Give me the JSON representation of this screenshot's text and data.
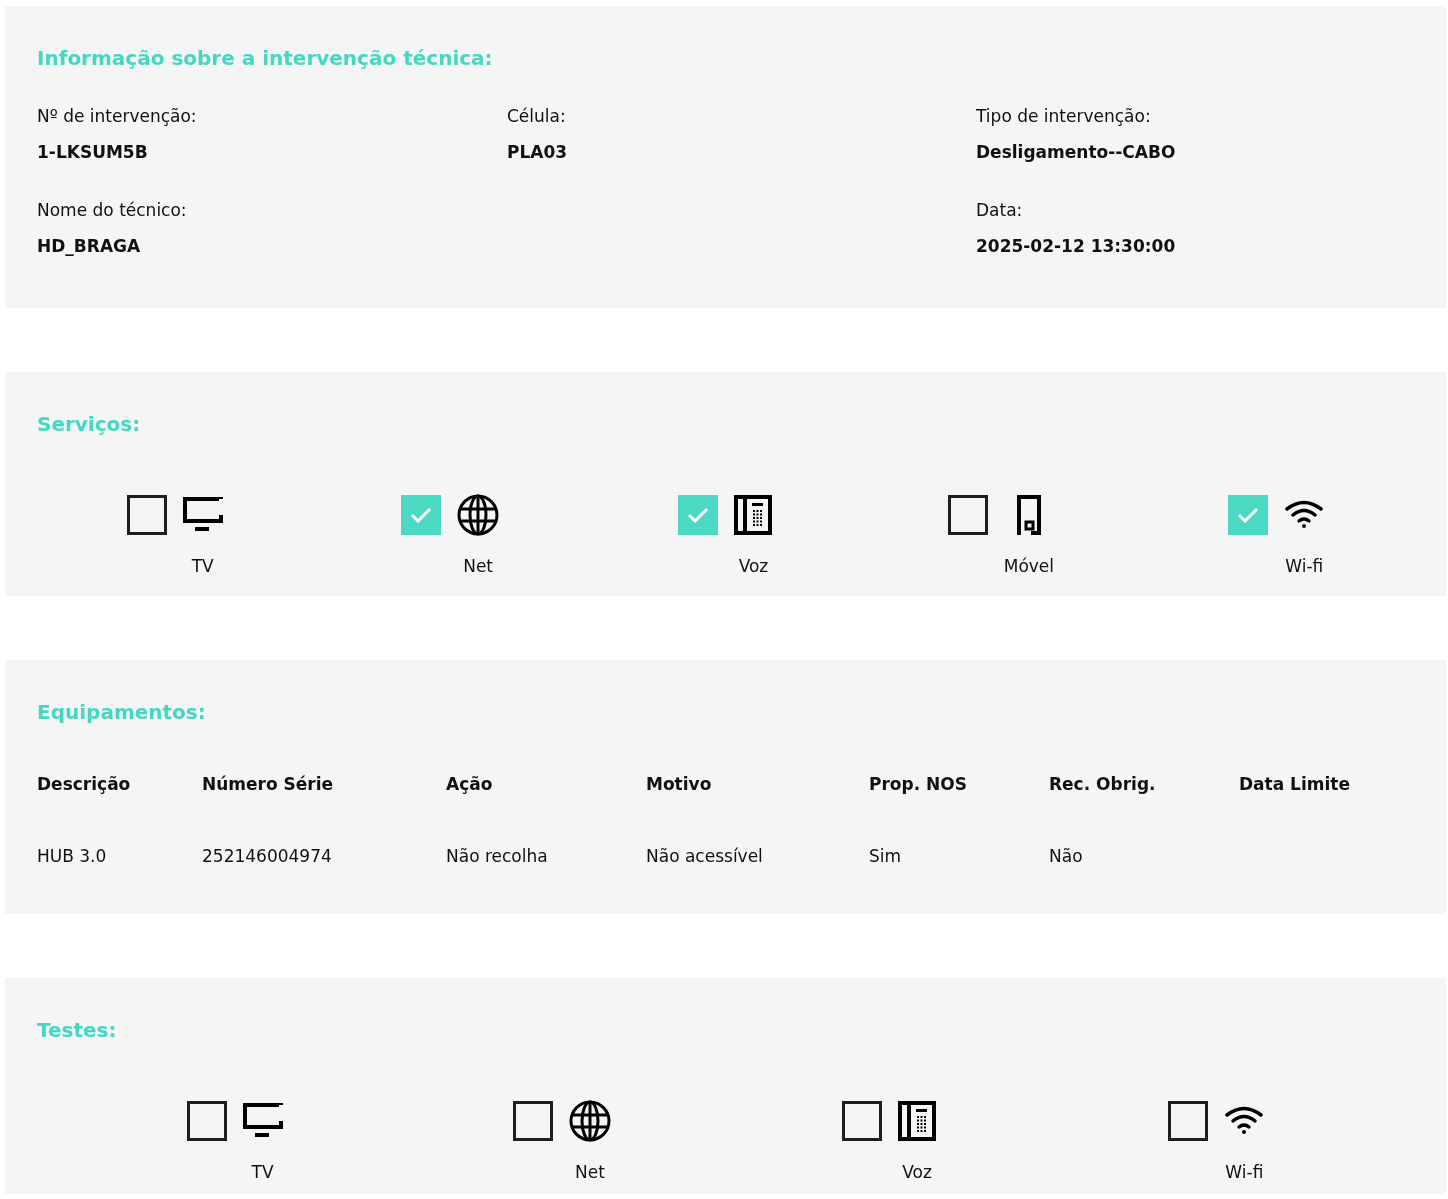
{
  "info": {
    "title": "Informação sobre a intervenção técnica:",
    "columns": [
      [
        {
          "label": "Nº de intervenção:",
          "value": "1-LKSUM5B"
        },
        {
          "label": "Nome do técnico:",
          "value": "HD_BRAGA"
        }
      ],
      [
        {
          "label": "Célula:",
          "value": "PLA03"
        }
      ],
      [
        {
          "label": "Tipo de intervenção:",
          "value": "Desligamento--CABO"
        },
        {
          "label": "Data:",
          "value": "2025-02-12 13:30:00"
        }
      ]
    ]
  },
  "services": {
    "title": "Serviços:",
    "items": [
      {
        "label": "TV",
        "kind": "tv",
        "checked": false
      },
      {
        "label": "Net",
        "kind": "globe",
        "checked": true
      },
      {
        "label": "Voz",
        "kind": "phone",
        "checked": true
      },
      {
        "label": "Móvel",
        "kind": "mobile",
        "checked": false
      },
      {
        "label": "Wi-fi",
        "kind": "wifi",
        "checked": true
      }
    ]
  },
  "equipment": {
    "title": "Equipamentos:",
    "columns": [
      "Descrição",
      "Número Série",
      "Ação",
      "Motivo",
      "Prop. NOS",
      "Rec. Obrig.",
      "Data Limite"
    ],
    "rows": [
      [
        "HUB 3.0",
        "252146004974",
        "Não recolha",
        "Não acessível",
        "Sim",
        "Não"
      ]
    ]
  },
  "tests": {
    "title": "Testes:",
    "items": [
      {
        "label": "TV",
        "kind": "tv",
        "checked": false
      },
      {
        "label": "Net",
        "kind": "globe",
        "checked": false
      },
      {
        "label": "Voz",
        "kind": "phone",
        "checked": false
      },
      {
        "label": "Wi-fi",
        "kind": "wifi",
        "checked": false
      }
    ]
  }
}
